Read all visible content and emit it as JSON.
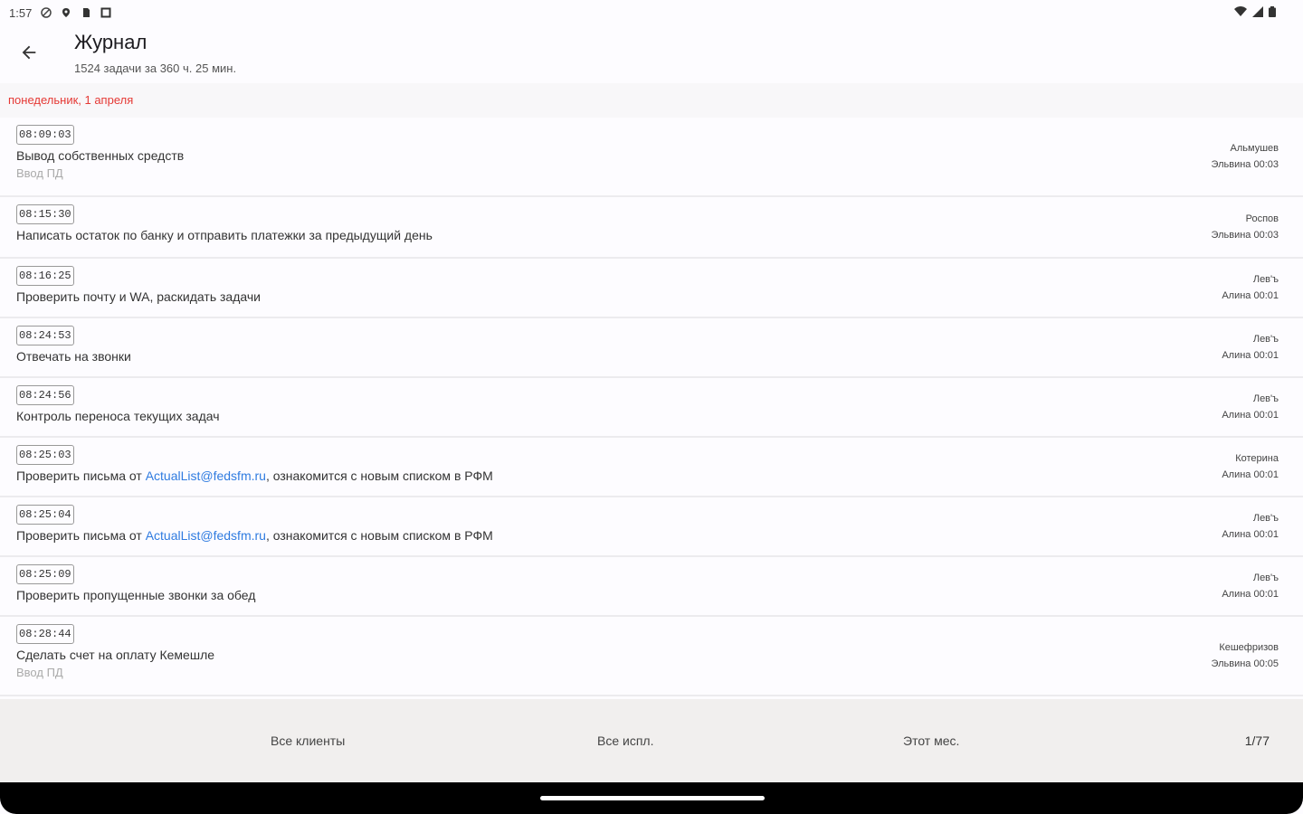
{
  "status_bar": {
    "time": "1:57"
  },
  "header": {
    "title": "Журнал",
    "subtitle": "1524 задачи за 360 ч. 25 мин."
  },
  "date_group": "понедельник, 1 апреля",
  "tasks": [
    {
      "time": "08:09:03",
      "text": "Вывод собственных средств",
      "sub": "Ввод ПД",
      "assignee": "Альмушев",
      "meta": "Эльвина 00:03"
    },
    {
      "time": "08:15:30",
      "text": "Написать остаток по банку и отправить платежки за предыдущий день",
      "sub": "",
      "assignee": "Роспов",
      "meta": "Эльвина 00:03"
    },
    {
      "time": "08:16:25",
      "text": "Проверить почту и WA, раскидать задачи",
      "sub": "",
      "assignee": "Лев'ъ",
      "meta": "Алина 00:01"
    },
    {
      "time": "08:24:53",
      "text": "Отвечать на звонки",
      "sub": "",
      "assignee": "Лев'ъ",
      "meta": "Алина 00:01"
    },
    {
      "time": "08:24:56",
      "text": "Контроль переноса текущих задач",
      "sub": "",
      "assignee": "Лев'ъ",
      "meta": "Алина 00:01"
    },
    {
      "time": "08:25:03",
      "text_before": "Проверить письма от ",
      "link": "ActualList@fedsfm.ru",
      "text_after": ", ознакомится с новым списком в РФМ",
      "sub": "",
      "assignee": "Котерина",
      "meta": "Алина 00:01"
    },
    {
      "time": "08:25:04",
      "text_before": "Проверить письма от ",
      "link": "ActualList@fedsfm.ru",
      "text_after": ", ознакомится с новым списком в РФМ",
      "sub": "",
      "assignee": "Лев'ъ",
      "meta": "Алина 00:01"
    },
    {
      "time": "08:25:09",
      "text": "Проверить пропущенные звонки за обед",
      "sub": "",
      "assignee": "Лев'ъ",
      "meta": "Алина 00:01"
    },
    {
      "time": "08:28:44",
      "text": "Сделать счет на оплату Кемешле",
      "sub": "Ввод ПД",
      "assignee": "Кешефризов",
      "meta": "Эльвина 00:05"
    }
  ],
  "filters": {
    "clients": "Все клиенты",
    "executors": "Все испл.",
    "period": "Этот мес.",
    "pager": "1/77"
  },
  "colors": {
    "date_header_text": "#e53935",
    "link": "#2f7be0",
    "bottom_bar_bg": "#f1efee"
  }
}
